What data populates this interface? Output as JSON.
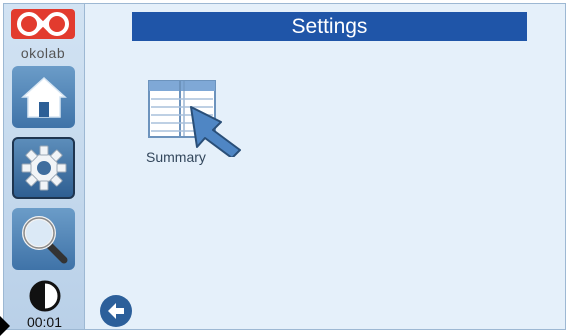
{
  "brand": {
    "logo_text": "okolab"
  },
  "header": {
    "title": "Settings"
  },
  "sidebar": {
    "items": [
      {
        "name": "home",
        "icon": "home-icon"
      },
      {
        "name": "settings",
        "icon": "gear-icon",
        "active": true
      },
      {
        "name": "search",
        "icon": "magnifier-icon"
      }
    ],
    "clock_icon": "half-circle-icon",
    "clock_text": "00:01"
  },
  "main": {
    "tiles": [
      {
        "label": "Summary",
        "icon": "table-icon"
      }
    ]
  },
  "footer": {
    "back_icon": "back-arrow-icon"
  },
  "colors": {
    "title_bar": "#1f55a8",
    "background": "#e5f0fa",
    "nav_button": "#4d82b7",
    "logo_red": "#e23b2e"
  }
}
